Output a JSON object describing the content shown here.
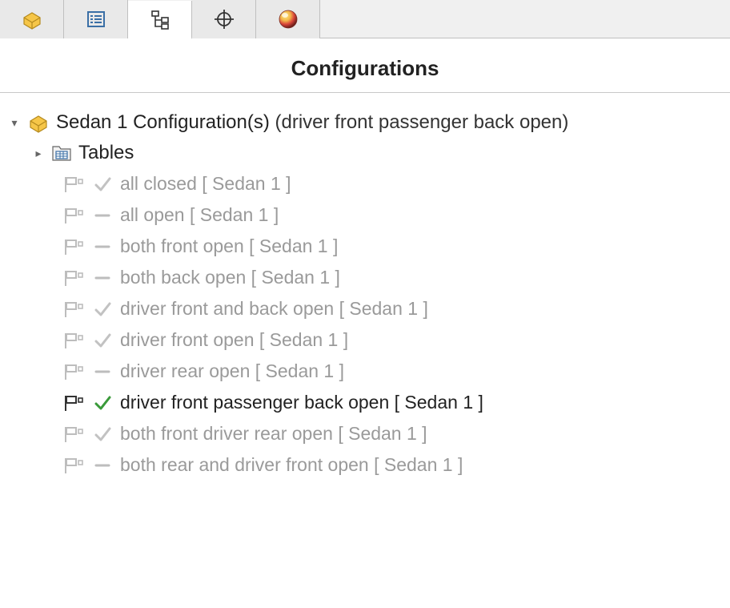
{
  "panel": {
    "title": "Configurations"
  },
  "root": {
    "name": "Sedan 1 Configuration(s)",
    "active_suffix": "  (driver front passenger back open)"
  },
  "tables": {
    "label": "Tables"
  },
  "configs": [
    {
      "label": "all closed [ Sedan 1 ]",
      "status": "check",
      "active": false
    },
    {
      "label": "all open [ Sedan 1 ]",
      "status": "dash",
      "active": false
    },
    {
      "label": "both front open [ Sedan 1 ]",
      "status": "dash",
      "active": false
    },
    {
      "label": "both back open [ Sedan 1 ]",
      "status": "dash",
      "active": false
    },
    {
      "label": "driver front and back open [ Sedan 1 ]",
      "status": "check",
      "active": false
    },
    {
      "label": "driver front open [ Sedan 1 ]",
      "status": "check",
      "active": false
    },
    {
      "label": "driver rear open [ Sedan 1 ]",
      "status": "dash",
      "active": false
    },
    {
      "label": "driver front passenger back open [ Sedan 1 ]",
      "status": "check",
      "active": true
    },
    {
      "label": "both front driver rear open [ Sedan 1 ]",
      "status": "check",
      "active": false
    },
    {
      "label": "both rear and driver front open [ Sedan 1 ]",
      "status": "dash",
      "active": false
    }
  ]
}
